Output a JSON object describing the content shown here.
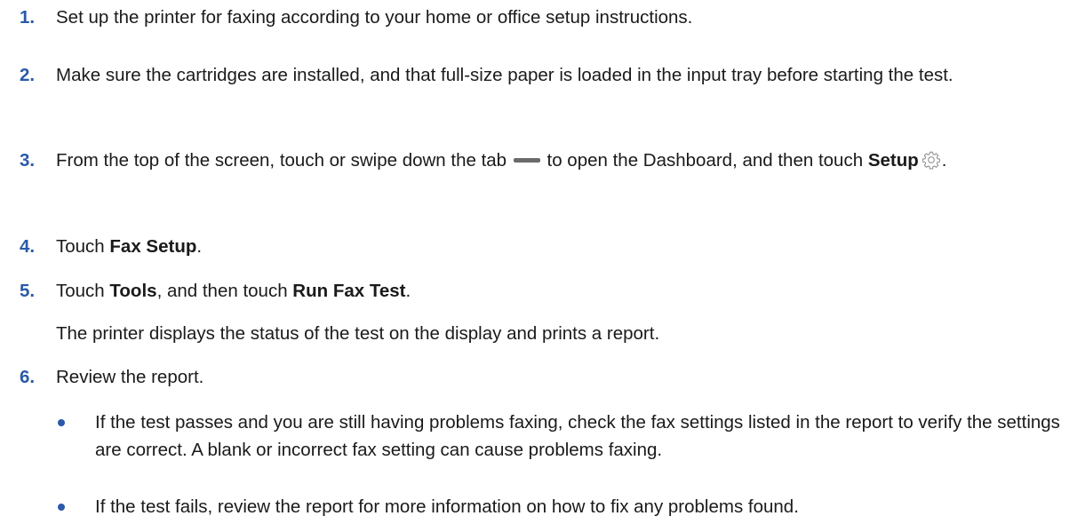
{
  "steps": [
    {
      "num": "1.",
      "text": "Set up the printer for faxing according to your home or office setup instructions."
    },
    {
      "num": "2.",
      "text": "Make sure the cartridges are installed, and that full-size paper is loaded in the input tray before starting the test."
    },
    {
      "num": "3.",
      "text_a": "From the top of the screen, touch or swipe down the tab",
      "text_b": "to open the Dashboard, and then touch",
      "bold_a": "Setup",
      "text_c": "."
    },
    {
      "num": "4.",
      "text_a": "Touch ",
      "bold_a": "Fax Setup",
      "text_b": "."
    },
    {
      "num": "5.",
      "text_a": "Touch ",
      "bold_a": "Tools",
      "text_b": ", and then touch ",
      "bold_b": "Run Fax Test",
      "text_c": ".",
      "note": "The printer displays the status of the test on the display and prints a report."
    },
    {
      "num": "6.",
      "text": "Review the report.",
      "bullets": [
        "If the test passes and you are still having problems faxing, check the fax settings listed in the report to verify the settings are correct. A blank or incorrect fax setting can cause problems faxing.",
        "If the test fails, review the report for more information on how to fix any problems found."
      ]
    }
  ]
}
